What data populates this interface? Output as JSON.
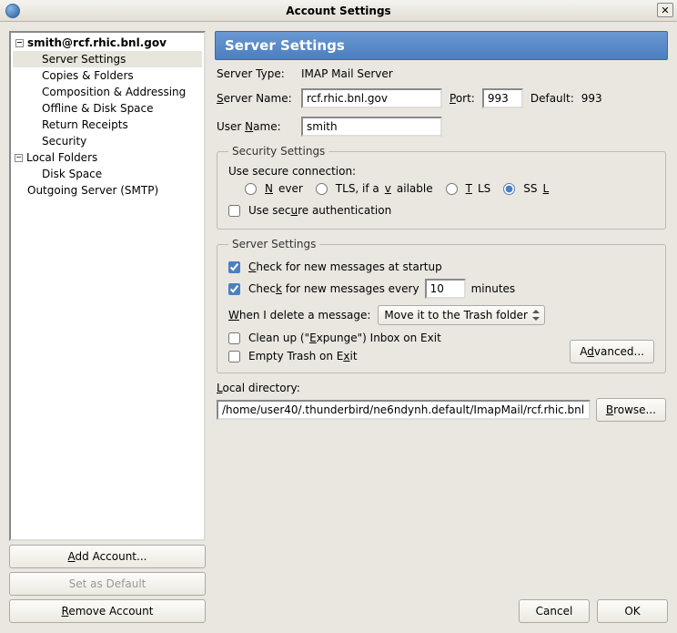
{
  "titlebar": {
    "title": "Account Settings"
  },
  "tree": {
    "accounts": [
      {
        "label": "smith@rcf.rhic.bnl.gov",
        "expanded": true,
        "children": [
          "Server Settings",
          "Copies & Folders",
          "Composition & Addressing",
          "Offline & Disk Space",
          "Return Receipts",
          "Security"
        ]
      },
      {
        "label": "Local Folders",
        "expanded": true,
        "children": [
          "Disk Space"
        ]
      },
      {
        "label": "Outgoing Server (SMTP)",
        "expanded": false,
        "children": []
      }
    ],
    "selected": "Server Settings"
  },
  "left_buttons": {
    "add": "Add Account...",
    "default": "Set as Default",
    "remove": "Remove Account"
  },
  "panel": {
    "heading": "Server Settings",
    "server_type_label": "Server Type:",
    "server_type_value": "IMAP Mail Server",
    "server_name_label": "Server Name:",
    "server_name_value": "rcf.rhic.bnl.gov",
    "port_label": "Port:",
    "port_value": "993",
    "default_port_label": "Default:",
    "default_port_value": "993",
    "user_name_label": "User Name:",
    "user_name_value": "smith"
  },
  "security": {
    "legend": "Security Settings",
    "use_secure_conn_label": "Use secure connection:",
    "options": {
      "never": "Never",
      "tls_avail": "TLS, if available",
      "tls": "TLS",
      "ssl": "SSL"
    },
    "selected": "ssl",
    "use_secure_auth_label": "Use secure authentication",
    "use_secure_auth_checked": false
  },
  "server_settings": {
    "legend": "Server Settings",
    "check_startup_label": "Check for new messages at startup",
    "check_startup_checked": true,
    "check_every_pre": "Check for new messages every",
    "check_every_value": "10",
    "check_every_post": "minutes",
    "check_every_checked": true,
    "delete_label": "When I delete a message:",
    "delete_value": "Move it to the Trash folder",
    "cleanup_label": "Clean up (\"Expunge\") Inbox on Exit",
    "cleanup_checked": false,
    "empty_label": "Empty Trash on Exit",
    "empty_checked": false,
    "advanced_label": "Advanced..."
  },
  "local_dir": {
    "label": "Local directory:",
    "value": "/home/user40/.thunderbird/ne6ndynh.default/ImapMail/rcf.rhic.bnl",
    "browse": "Browse..."
  },
  "dialog": {
    "cancel": "Cancel",
    "ok": "OK"
  }
}
